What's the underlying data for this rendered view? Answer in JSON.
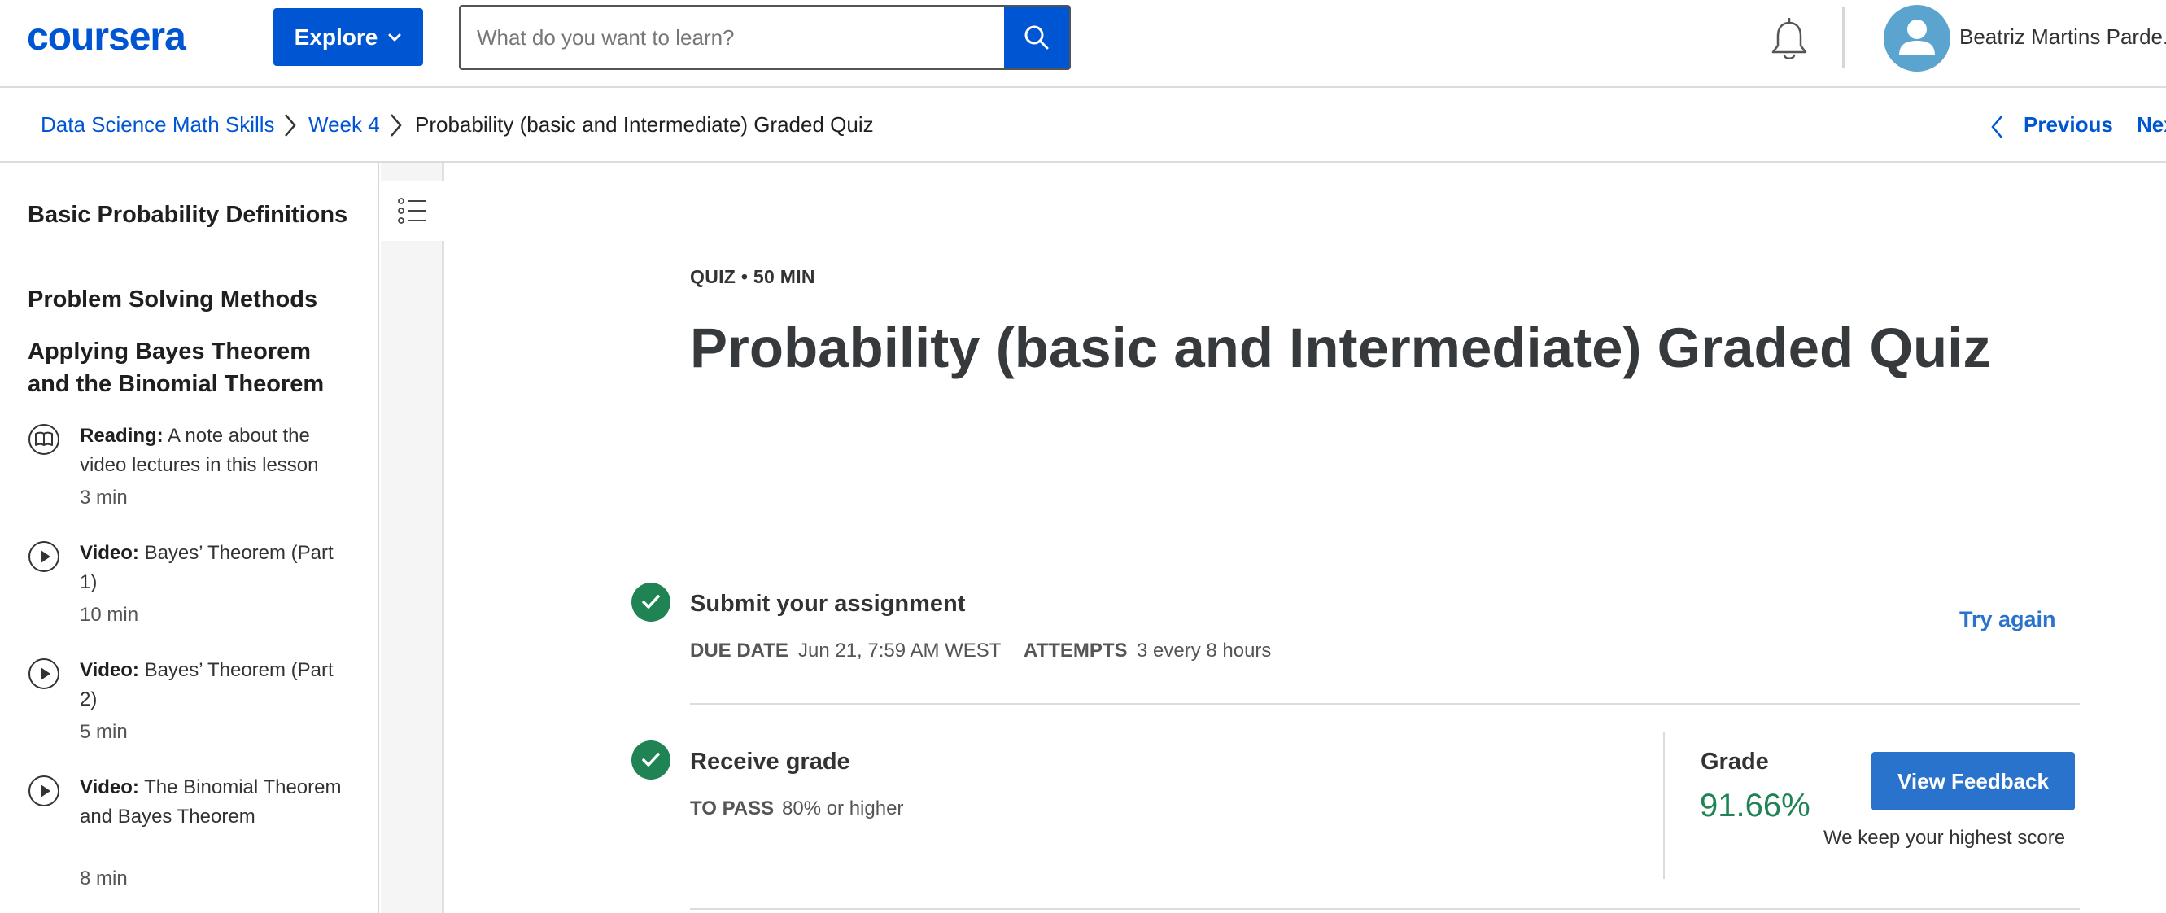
{
  "header": {
    "logo": "coursera",
    "explore_label": "Explore",
    "search_placeholder": "What do you want to learn?",
    "user_name": "Beatriz Martins Parde..."
  },
  "breadcrumb": {
    "items": [
      "Data Science Math Skills",
      "Week 4",
      "Probability (basic and Intermediate) Graded Quiz"
    ],
    "previous_label": "Previous",
    "next_label": "Next"
  },
  "sidebar": {
    "sections": [
      "Basic Probability Definitions",
      "Problem Solving Methods",
      "Applying Bayes Theorem and the Binomial Theorem"
    ],
    "items": [
      {
        "icon": "book-icon",
        "type": "Reading:",
        "title": "A note about the video lectures in this lesson",
        "duration": "3 min"
      },
      {
        "icon": "play-icon",
        "type": "Video:",
        "title": "Bayes’ Theorem (Part 1)",
        "duration": "10 min"
      },
      {
        "icon": "play-icon",
        "type": "Video:",
        "title": "Bayes’ Theorem (Part 2)",
        "duration": "5 min"
      },
      {
        "icon": "play-icon",
        "type": "Video:",
        "title": "The Binomial Theorem and Bayes Theorem",
        "duration": "8 min"
      }
    ]
  },
  "main": {
    "eyebrow": "QUIZ • 50 MIN",
    "title": "Probability (basic and Intermediate) Graded Quiz",
    "submit": {
      "title": "Submit your assignment",
      "due_label": "DUE DATE",
      "due_value": "Jun 21, 7:59 AM WEST",
      "attempts_label": "ATTEMPTS",
      "attempts_value": "3 every 8 hours",
      "try_again": "Try again"
    },
    "grade": {
      "title": "Receive grade",
      "pass_label": "TO PASS",
      "pass_value": "80% or higher",
      "grade_label": "Grade",
      "grade_value": "91.66%",
      "feedback_button": "View Feedback",
      "note": "We keep your highest score"
    }
  },
  "colors": {
    "brand": "#0056d2",
    "success": "#1f8354",
    "button": "#2a73cc"
  }
}
